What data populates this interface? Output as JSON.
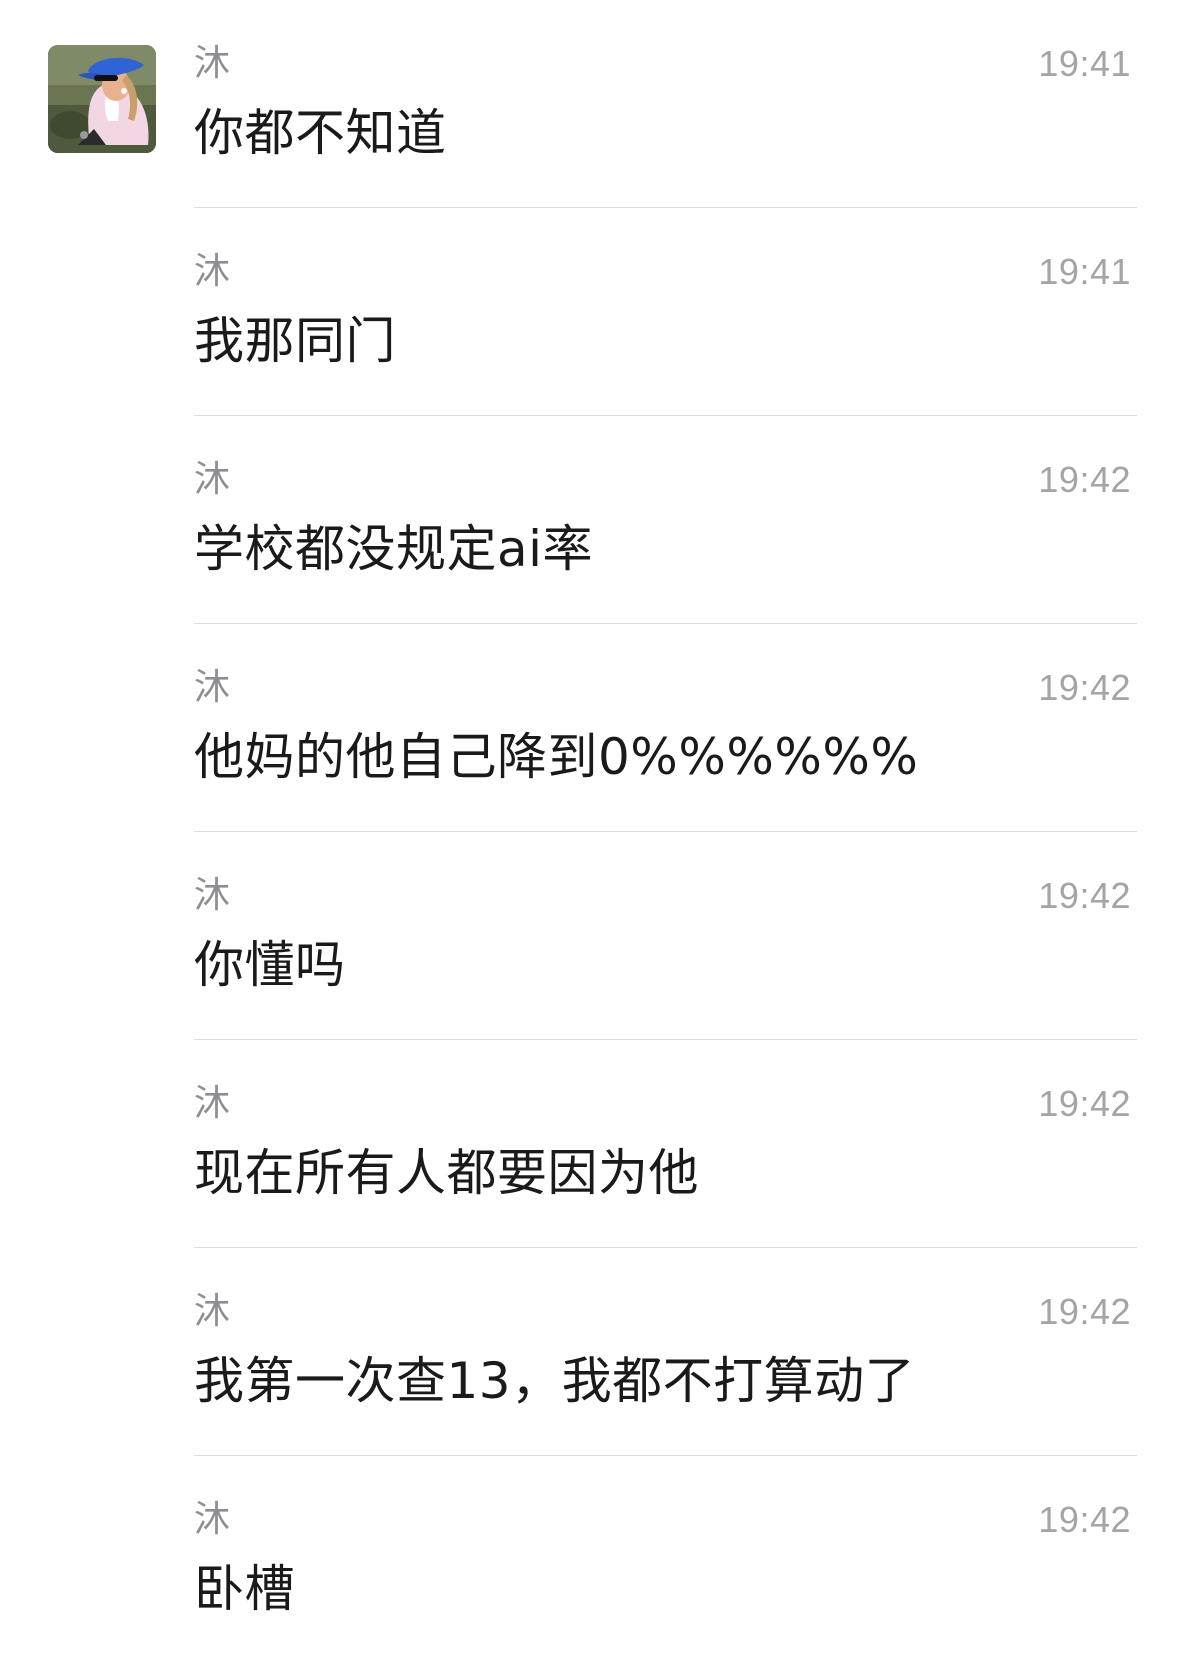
{
  "messages": [
    {
      "sender": "沐",
      "time": "19:41",
      "text": "你都不知道",
      "has_avatar": true
    },
    {
      "sender": "沐",
      "time": "19:41",
      "text": "我那同门"
    },
    {
      "sender": "沐",
      "time": "19:42",
      "text": "学校都没规定ai率"
    },
    {
      "sender": "沐",
      "time": "19:42",
      "text": "他妈的他自己降到0%%%%%%"
    },
    {
      "sender": "沐",
      "time": "19:42",
      "text": "你懂吗"
    },
    {
      "sender": "沐",
      "time": "19:42",
      "text": "现在所有人都要因为他"
    },
    {
      "sender": "沐",
      "time": "19:42",
      "text": "我第一次查13，我都不打算动了"
    },
    {
      "sender": "沐",
      "time": "19:42",
      "text": "卧槽"
    }
  ],
  "colors": {
    "background": "#ffffff",
    "sender": "#8e8e93",
    "time": "#a3a3a8",
    "message_text": "#1a1a1a",
    "divider": "#dcdcdc"
  }
}
